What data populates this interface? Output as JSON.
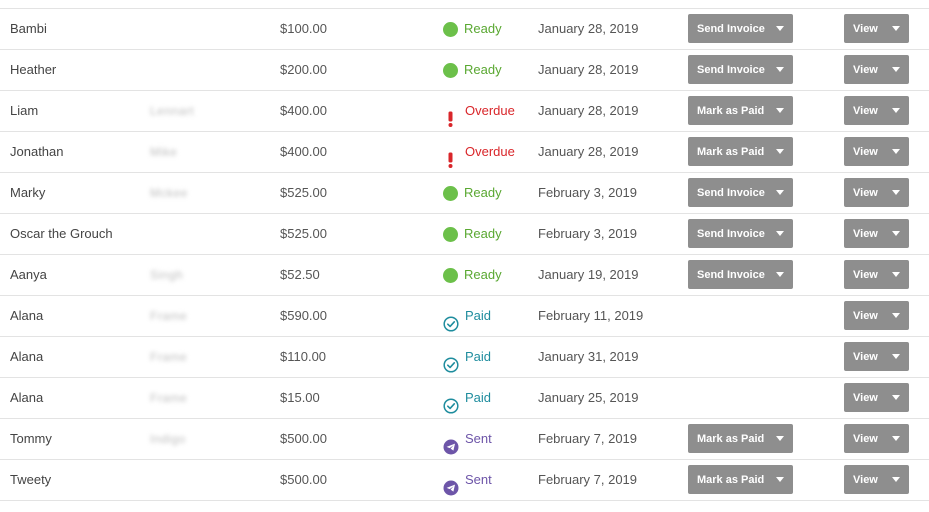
{
  "colors": {
    "ready": "#6cc04a",
    "overdue": "#d9262a",
    "paid": "#1f8d9e",
    "sent": "#6d55a8",
    "button_bg": "#8e8e8e"
  },
  "rows": [
    {
      "first": "Bambi",
      "last": "",
      "amount": "$100.00",
      "status": "Ready",
      "status_type": "ready",
      "date": "January 28, 2019",
      "action": "Send Invoice",
      "view": "View"
    },
    {
      "first": "Heather",
      "last": "",
      "amount": "$200.00",
      "status": "Ready",
      "status_type": "ready",
      "date": "January 28, 2019",
      "action": "Send Invoice",
      "view": "View"
    },
    {
      "first": "Liam",
      "last": "Lennart",
      "amount": "$400.00",
      "status": "Overdue",
      "status_type": "overdue",
      "date": "January 28, 2019",
      "action": "Mark as Paid",
      "view": "View"
    },
    {
      "first": "Jonathan",
      "last": "Mike",
      "amount": "$400.00",
      "status": "Overdue",
      "status_type": "overdue",
      "date": "January 28, 2019",
      "action": "Mark as Paid",
      "view": "View"
    },
    {
      "first": "Marky",
      "last": "Mckee",
      "amount": "$525.00",
      "status": "Ready",
      "status_type": "ready",
      "date": "February 3, 2019",
      "action": "Send Invoice",
      "view": "View"
    },
    {
      "first": "Oscar the Grouch",
      "last": "",
      "amount": "$525.00",
      "status": "Ready",
      "status_type": "ready",
      "date": "February 3, 2019",
      "action": "Send Invoice",
      "view": "View"
    },
    {
      "first": "Aanya",
      "last": "Singh",
      "amount": "$52.50",
      "status": "Ready",
      "status_type": "ready",
      "date": "January 19, 2019",
      "action": "Send Invoice",
      "view": "View"
    },
    {
      "first": "Alana",
      "last": "Frame",
      "amount": "$590.00",
      "status": "Paid",
      "status_type": "paid",
      "date": "February 11, 2019",
      "action": "",
      "view": "View"
    },
    {
      "first": "Alana",
      "last": "Frame",
      "amount": "$110.00",
      "status": "Paid",
      "status_type": "paid",
      "date": "January 31, 2019",
      "action": "",
      "view": "View"
    },
    {
      "first": "Alana",
      "last": "Frame",
      "amount": "$15.00",
      "status": "Paid",
      "status_type": "paid",
      "date": "January 25, 2019",
      "action": "",
      "view": "View"
    },
    {
      "first": "Tommy",
      "last": "Indigo",
      "amount": "$500.00",
      "status": "Sent",
      "status_type": "sent",
      "date": "February 7, 2019",
      "action": "Mark as Paid",
      "view": "View"
    },
    {
      "first": "Tweety",
      "last": "",
      "amount": "$500.00",
      "status": "Sent",
      "status_type": "sent",
      "date": "February 7, 2019",
      "action": "Mark as Paid",
      "view": "View"
    }
  ]
}
